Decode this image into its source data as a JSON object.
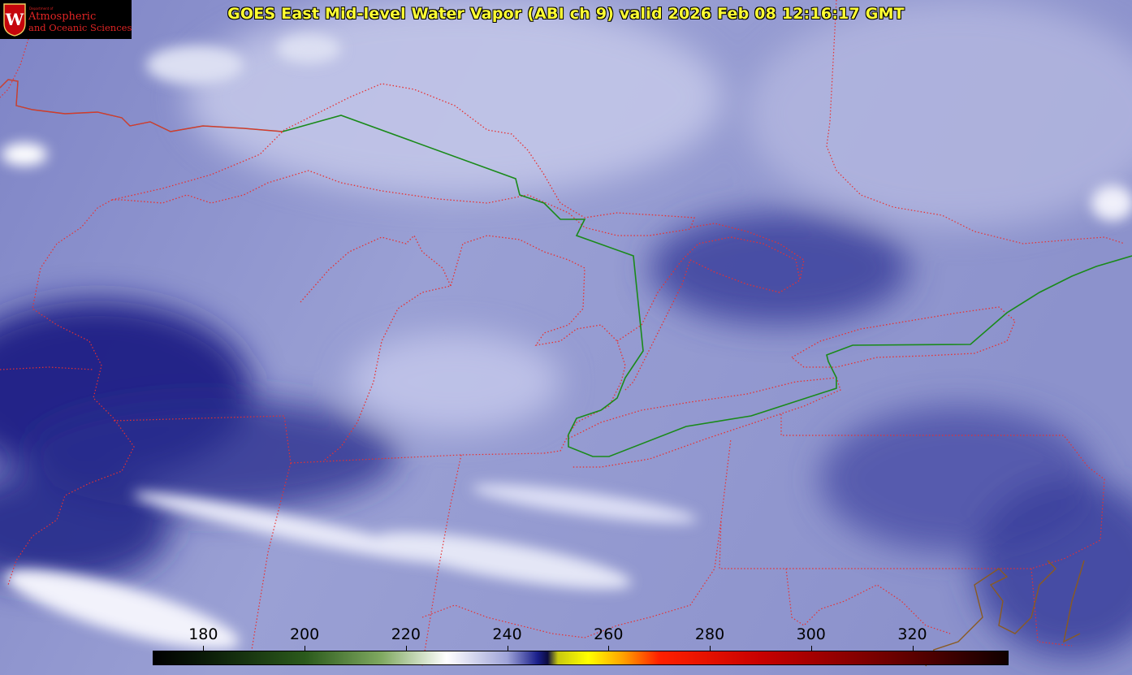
{
  "title": "GOES East Mid-level Water Vapor (ABI ch 9)  valid 2026 Feb 08 12:16:17 GMT",
  "logo": {
    "small_text": "Department of",
    "line1": "Atmospheric",
    "line2": "and Oceanic Sciences",
    "seal_letter": "W"
  },
  "colorbar": {
    "unit_ticks": [
      "180",
      "200",
      "220",
      "240",
      "260",
      "280",
      "300",
      "320"
    ],
    "min": 170,
    "max": 339,
    "stops": [
      {
        "value": 170,
        "color": "#000000"
      },
      {
        "value": 180,
        "color": "#0a1a08"
      },
      {
        "value": 200,
        "color": "#2b5a1c"
      },
      {
        "value": 215,
        "color": "#7fa860"
      },
      {
        "value": 228,
        "color": "#ffffff"
      },
      {
        "value": 240,
        "color": "#9ea3d8"
      },
      {
        "value": 246,
        "color": "#1a1f8a"
      },
      {
        "value": 248,
        "color": "#0c0c40"
      },
      {
        "value": 250,
        "color": "#c8c810"
      },
      {
        "value": 256,
        "color": "#ffff00"
      },
      {
        "value": 263,
        "color": "#ffa000"
      },
      {
        "value": 270,
        "color": "#ff2000"
      },
      {
        "value": 290,
        "color": "#c80000"
      },
      {
        "value": 315,
        "color": "#700000"
      },
      {
        "value": 339,
        "color": "#100000"
      }
    ]
  },
  "colors": {
    "state_border": "#e83030",
    "intl_border": "#1a8a1a",
    "coast_outline": "#8a5a20",
    "title": "#ffff33"
  }
}
